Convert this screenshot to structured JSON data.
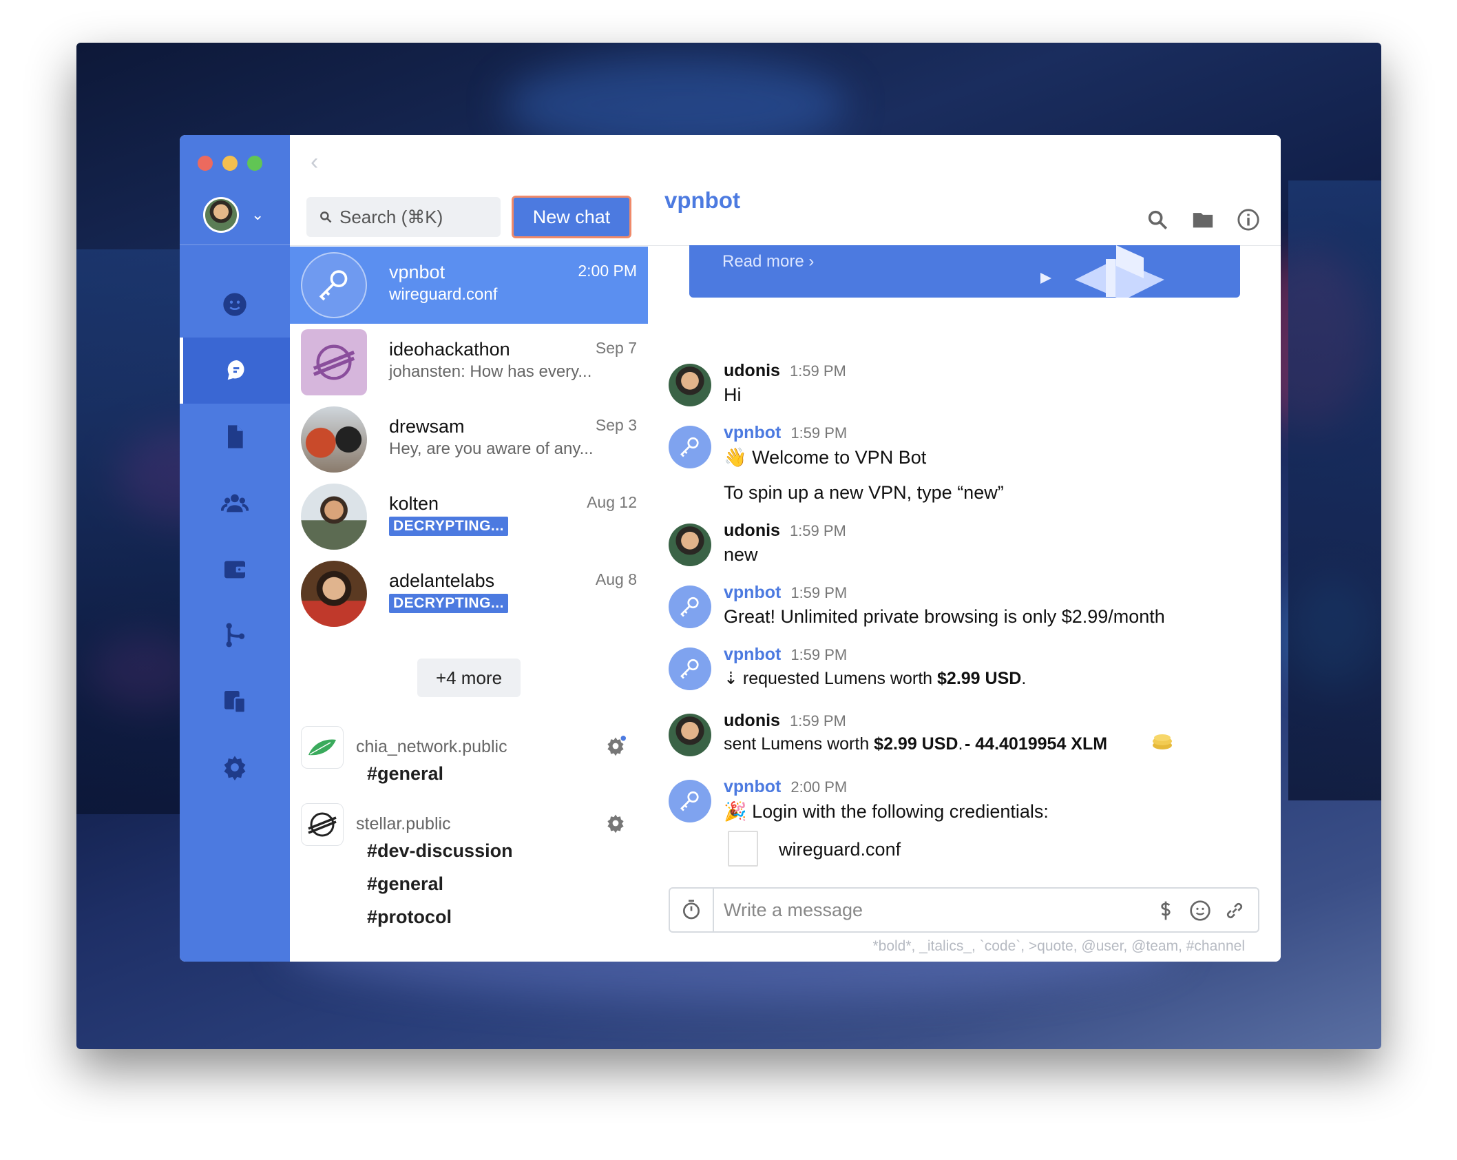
{
  "window": {
    "title": "vpnbot"
  },
  "search": {
    "placeholder": "Search (⌘K)"
  },
  "new_chat_label": "New chat",
  "conversations": [
    {
      "name": "vpnbot",
      "time": "2:00 PM",
      "snippet": "wireguard.conf",
      "selected": true
    },
    {
      "name": "ideohackathon",
      "time": "Sep 7",
      "snippet": "johansten: How has every..."
    },
    {
      "name": "drewsam",
      "time": "Sep 3",
      "snippet": "Hey, are you aware of any..."
    },
    {
      "name": "kolten",
      "time": "Aug 12",
      "badge": "DECRYPTING..."
    },
    {
      "name": "adelantelabs",
      "time": "Aug 8",
      "badge": "DECRYPTING..."
    }
  ],
  "more_label": "+4 more",
  "teams": [
    {
      "name": "chia_network.public",
      "channels": [
        "#general"
      ]
    },
    {
      "name": "stellar.public",
      "channels": [
        "#dev-discussion",
        "#general",
        "#protocol"
      ]
    }
  ],
  "banner": {
    "read_more": "Read more ›"
  },
  "messages": [
    {
      "author": "udonis",
      "time": "1:59 PM",
      "lines": [
        "Hi"
      ]
    },
    {
      "author": "vpnbot",
      "time": "1:59 PM",
      "lines": [
        "👋 Welcome to VPN Bot",
        "To spin up a new VPN, type “new”"
      ]
    },
    {
      "author": "udonis",
      "time": "1:59 PM",
      "lines": [
        "new"
      ]
    },
    {
      "author": "vpnbot",
      "time": "1:59 PM",
      "lines": [
        "Great! Unlimited private browsing is only $2.99/month"
      ]
    },
    {
      "author": "vpnbot",
      "time": "1:59 PM",
      "request_prefix": "requested Lumens worth ",
      "request_amount": "$2.99 USD",
      "request_suffix": "."
    },
    {
      "author": "udonis",
      "time": "1:59 PM",
      "sent_prefix": "sent Lumens worth ",
      "sent_amount": "$2.99 USD",
      "sent_suffix": ".",
      "xlm": "- 44.4019954 XLM"
    },
    {
      "author": "vpnbot",
      "time": "2:00 PM",
      "lines": [
        "🎉 Login with the following credientials:"
      ],
      "attachment": "wireguard.conf"
    }
  ],
  "composer": {
    "placeholder": "Write a message"
  },
  "format_hint": "*bold*, _italics_, `code`, >quote, @user, @team, #channel",
  "colors": {
    "accent": "#4c7ae0",
    "rail": "#4c7ae0",
    "selected": "#5b8ff0",
    "payment": "#5a4fc7"
  }
}
